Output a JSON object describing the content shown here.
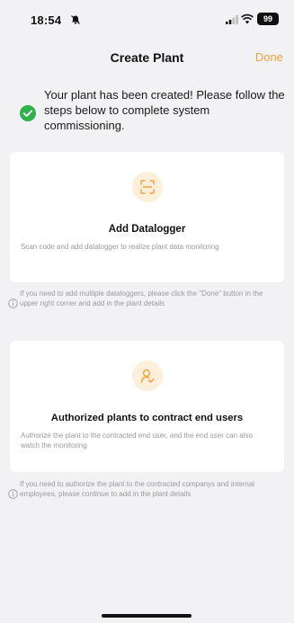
{
  "status_bar": {
    "time": "18:54",
    "battery": "99"
  },
  "nav": {
    "title": "Create Plant",
    "done_label": "Done"
  },
  "success": {
    "message": "Your plant has been created! Please follow the steps below to complete system commissioning."
  },
  "cards": [
    {
      "icon": "scan-icon",
      "title": "Add Datalogger",
      "description": "Scan code and add datalogger to realize plant data monitoring"
    },
    {
      "icon": "user-authorize-icon",
      "title": "Authorized plants to contract end users",
      "description": "Authorize the plant to the contracted end user, and the end user can also watch the monitoring"
    }
  ],
  "notes": [
    "If you need to add multiple dataloggers, please click the \"Done\" button in the upper right corner and add in the plant details",
    "If you need to authorize the plant to the contracted companys and internal employees, please continue to add in the plant details"
  ],
  "colors": {
    "accent": "#f3a23a",
    "success": "#2fb24b",
    "background": "#f2f2f4",
    "icon_bg": "#fcefdc"
  }
}
